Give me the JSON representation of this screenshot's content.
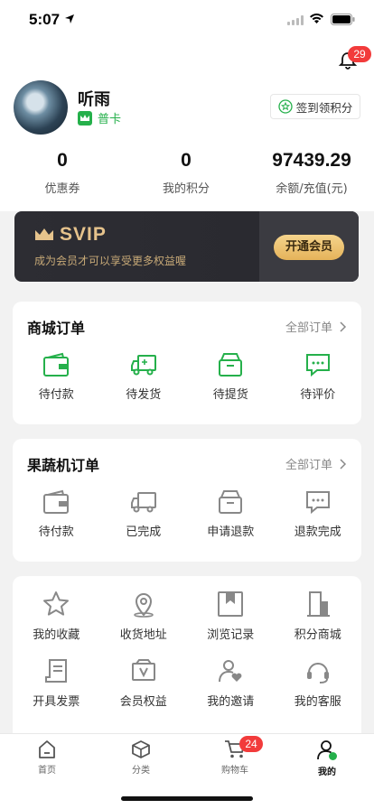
{
  "status_bar": {
    "time": "5:07"
  },
  "header": {
    "notification_count": "29"
  },
  "profile": {
    "username": "听雨",
    "level": "普卡",
    "checkin_label": "签到领积分"
  },
  "stats": [
    {
      "value": "0",
      "label": "优惠券"
    },
    {
      "value": "0",
      "label": "我的积分"
    },
    {
      "value": "97439.29",
      "label": "余额/充值(元)"
    }
  ],
  "svip": {
    "title": "SVIP",
    "desc": "成为会员才可以享受更多权益喔",
    "button": "开通会员"
  },
  "mall_orders": {
    "title": "商城订单",
    "link": "全部订单",
    "items": [
      {
        "label": "待付款",
        "icon": "wallet-icon"
      },
      {
        "label": "待发货",
        "icon": "truck-icon"
      },
      {
        "label": "待提货",
        "icon": "box-icon"
      },
      {
        "label": "待评价",
        "icon": "comment-icon"
      }
    ]
  },
  "vending_orders": {
    "title": "果蔬机订单",
    "link": "全部订单",
    "items": [
      {
        "label": "待付款",
        "icon": "wallet-icon"
      },
      {
        "label": "已完成",
        "icon": "truck-icon"
      },
      {
        "label": "申请退款",
        "icon": "box-icon"
      },
      {
        "label": "退款完成",
        "icon": "comment-icon"
      }
    ]
  },
  "services": [
    {
      "label": "我的收藏",
      "icon": "star-icon"
    },
    {
      "label": "收货地址",
      "icon": "location-icon"
    },
    {
      "label": "浏览记录",
      "icon": "bookmark-icon"
    },
    {
      "label": "积分商城",
      "icon": "building-icon"
    },
    {
      "label": "开具发票",
      "icon": "receipt-icon"
    },
    {
      "label": "会员权益",
      "icon": "vip-card-icon"
    },
    {
      "label": "我的邀请",
      "icon": "invite-icon"
    },
    {
      "label": "我的客服",
      "icon": "headset-icon"
    }
  ],
  "tabbar": {
    "items": [
      {
        "label": "首页"
      },
      {
        "label": "分类"
      },
      {
        "label": "购物车"
      },
      {
        "label": "我的"
      }
    ],
    "cart_count": "24"
  },
  "colors": {
    "accent": "#25b04b",
    "svip_gold": "#e6c38c",
    "badge": "#f23b3b"
  }
}
